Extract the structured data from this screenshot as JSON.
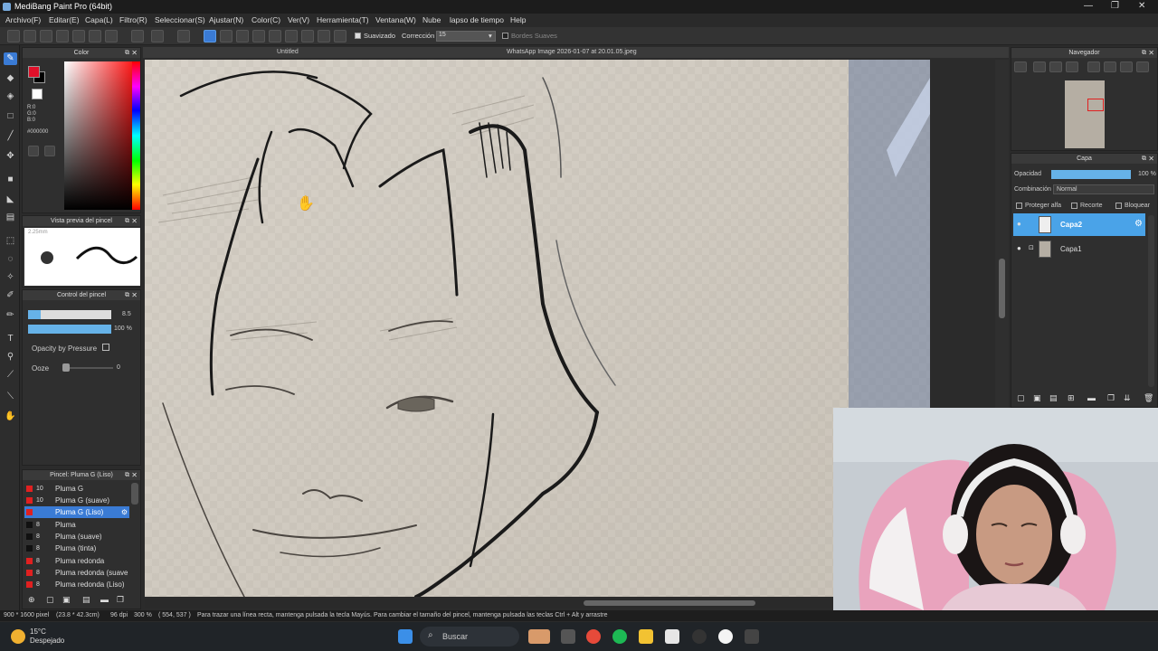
{
  "window": {
    "title": "MediBang Paint Pro (64bit)",
    "controls": [
      "—",
      "❐",
      "✕"
    ]
  },
  "menu": [
    "Archivo(F)",
    "Editar(E)",
    "Capa(L)",
    "Filtro(R)",
    "Seleccionar(S)",
    "Ajustar(N)",
    "Color(C)",
    "Ver(V)",
    "Herramienta(T)",
    "Ventana(W)",
    "Nube",
    "lapso de tiempo",
    "Help"
  ],
  "toolbar": {
    "suavizado_label": "Suavizado",
    "correccion_label": "Corrección",
    "correccion_value": "15",
    "bordes_label": "Bordes Suaves"
  },
  "color_panel": {
    "title": "Color",
    "fg_color": "#e0102a",
    "r": "R:0",
    "g": "G:0",
    "b": "B:0",
    "hex": "#000000"
  },
  "brush_preview": {
    "title": "Vista previa del pincel",
    "size": "2.25mm"
  },
  "brush_control": {
    "title": "Control del pincel",
    "size_value": "8.5",
    "opacity_value": "100 %",
    "opacity_by_pressure": "Opacity by Pressure",
    "ooze_label": "Ooze",
    "ooze_value": "0"
  },
  "brush_list": {
    "title": "Pincel: Pluma G (Liso)",
    "items": [
      {
        "size": "10",
        "name": "Pluma G",
        "color": "#e02020"
      },
      {
        "size": "10",
        "name": "Pluma G (suave)",
        "color": "#e02020"
      },
      {
        "size": "",
        "name": "Pluma G (Liso)",
        "color": "#e02020"
      },
      {
        "size": "8",
        "name": "Pluma",
        "color": "#111111"
      },
      {
        "size": "8",
        "name": "Pluma (suave)",
        "color": "#111111"
      },
      {
        "size": "8",
        "name": "Pluma (tinta)",
        "color": "#111111"
      },
      {
        "size": "8",
        "name": "Pluma redonda",
        "color": "#e02020"
      },
      {
        "size": "8",
        "name": "Pluma redonda (suave",
        "color": "#e02020"
      },
      {
        "size": "8",
        "name": "Pluma redonda (Liso)",
        "color": "#e02020"
      }
    ]
  },
  "canvas": {
    "tab_left": "Untitled",
    "tab_right": "WhatsApp Image 2026-01-07 at 20.01.05.jpeg"
  },
  "navigator": {
    "title": "Navegador"
  },
  "layers": {
    "title": "Capa",
    "opacity_label": "Opacidad",
    "opacity_value": "100 %",
    "blend_label": "Combinación",
    "blend_value": "Normal",
    "protect_alpha": "Proteger alfa",
    "clipping": "Recorte",
    "lock": "Bloquear",
    "items": [
      {
        "name": "Capa2",
        "selected": true
      },
      {
        "name": "Capa1",
        "selected": false
      }
    ]
  },
  "status": {
    "dims": "900 * 1600 pixel",
    "physical": "(23.8 * 42.3cm)",
    "dpi": "96 dpi",
    "zoom": "300 %",
    "coords": "( 554, 537 )",
    "hint": "Para trazar una línea recta, mantenga pulsada la tecla Mayús. Para cambiar el tamaño del pincel, mantenga pulsada las teclas Ctrl + Alt y arrastre"
  },
  "taskbar": {
    "temp": "15°C",
    "weather": "Despejado",
    "search": "Buscar"
  }
}
